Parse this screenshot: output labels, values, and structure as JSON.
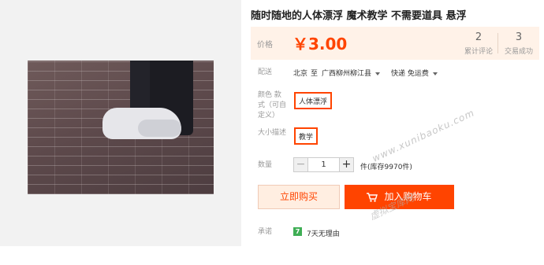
{
  "product": {
    "title": "随时随地的人体漂浮 魔术教学 不需要道具 悬浮"
  },
  "price": {
    "label": "价格",
    "value": "￥3.00"
  },
  "stats": [
    {
      "num": "2",
      "label": "累计评论"
    },
    {
      "num": "3",
      "label": "交易成功"
    }
  ],
  "shipping": {
    "label": "配送",
    "from": "北京",
    "to_word": "至",
    "destination": "广西柳州柳江县",
    "method": "快递 免运费"
  },
  "color": {
    "label_line1": "颜色 款",
    "label_line2": "式（可自",
    "label_line3": "定义）",
    "option": "人体漂浮"
  },
  "size": {
    "label": "大小描述",
    "option": "教学"
  },
  "quantity": {
    "label": "数量",
    "minus": "−",
    "value": "1",
    "plus": "+",
    "stock": "件(库存9970件)"
  },
  "actions": {
    "buy_now": "立即购买",
    "add_cart": "加入购物车"
  },
  "promise": {
    "label": "承诺",
    "badge": "7",
    "text": "7天无理由"
  },
  "watermark": {
    "url": "www.xunibaoku.com",
    "site": "虚拟宝库网"
  },
  "colors": {
    "accent": "#ff4400",
    "price_bg": "#fff2e8"
  }
}
